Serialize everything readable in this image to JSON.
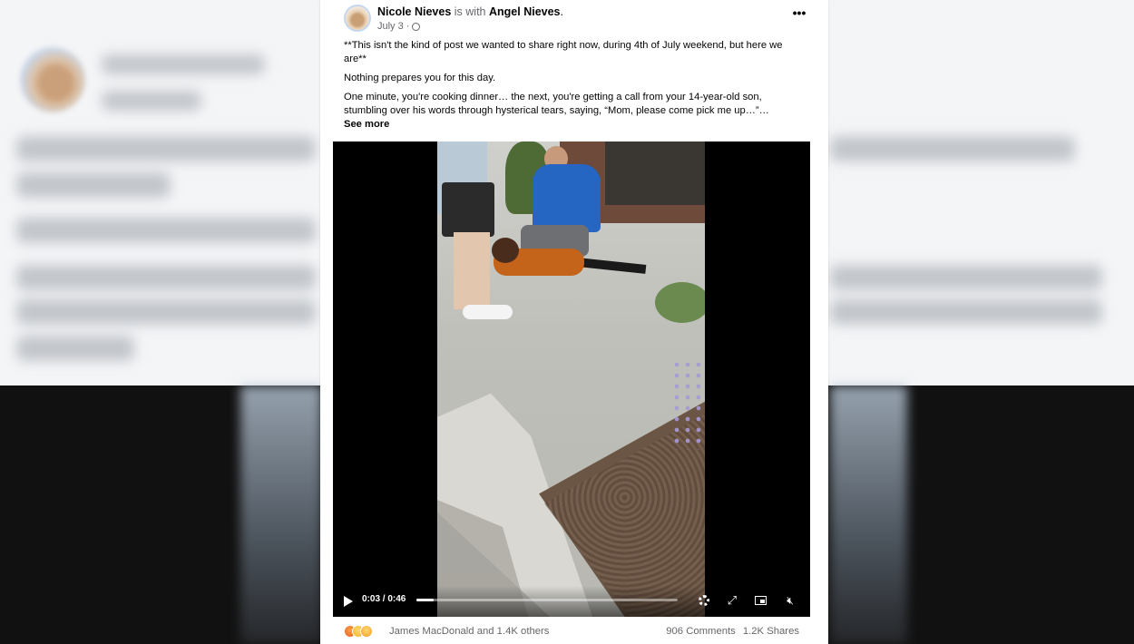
{
  "post": {
    "author": "Nicole Nieves",
    "with_label": "is with",
    "tagged": "Angel Nieves",
    "date": "July 3",
    "more_options": "•••",
    "text": {
      "p1": "**This isn't the kind of post we wanted to share right now, during 4th of July weekend, but here we are**",
      "p2": "Nothing prepares you for this day.",
      "p3": "One minute, you're cooking dinner… the next, you're getting a call from your 14-year-old son, stumbling over his words through hysterical tears, saying, “Mom, please come pick me up…”…",
      "see_more": "See more"
    }
  },
  "video": {
    "time_display": "0:03 / 0:46",
    "progress_fraction": 0.065,
    "icons": {
      "play": "play-icon",
      "settings": "gear-icon",
      "fullscreen": "expand-icon",
      "pip": "picture-in-picture-icon",
      "mute": "speaker-muted-icon"
    }
  },
  "footer": {
    "reaction_icons": [
      "angry-icon",
      "sad-icon",
      "care-icon"
    ],
    "reaction_names": "James MacDonald and 1.4K others",
    "comments": "906 Comments",
    "shares": "1.2K Shares"
  }
}
